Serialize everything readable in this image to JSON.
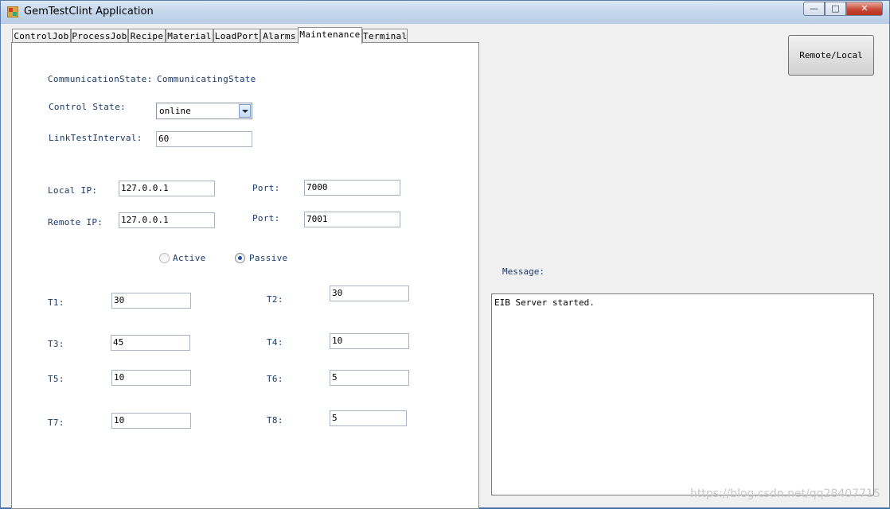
{
  "window": {
    "title": "GemTestClint Application",
    "controls": {
      "minimize": "—",
      "maximize": "□",
      "close": "✕"
    }
  },
  "tabs": [
    "ControlJob",
    "ProcessJob",
    "Recipe",
    "Material",
    "LoadPort",
    "Alarms",
    "Maintenance",
    "Terminal"
  ],
  "active_tab": "Maintenance",
  "maintenance": {
    "comm_state_label": "CommunicationState:",
    "comm_state_value": "CommunicatingState",
    "control_state_label": "Control State:",
    "control_state_value": "online",
    "link_test_label": "LinkTestInterval:",
    "link_test_value": "60",
    "local_ip_label": "Local IP:",
    "local_ip_value": "127.0.0.1",
    "local_port_label": "Port:",
    "local_port_value": "7000",
    "remote_ip_label": "Remote IP:",
    "remote_ip_value": "127.0.0.1",
    "remote_port_label": "Port:",
    "remote_port_value": "7001",
    "mode_active_label": "Active",
    "mode_passive_label": "Passive",
    "mode_selected": "Passive",
    "timers": {
      "t1_label": "T1:",
      "t1_value": "30",
      "t2_label": "T2:",
      "t2_value": "30",
      "t3_label": "T3:",
      "t3_value": "45",
      "t4_label": "T4:",
      "t4_value": "10",
      "t5_label": "T5:",
      "t5_value": "10",
      "t6_label": "T6:",
      "t6_value": "5",
      "t7_label": "T7:",
      "t7_value": "10",
      "t8_label": "T8:",
      "t8_value": "5"
    }
  },
  "remote_local_button": "Remote/Local",
  "message_label": "Message:",
  "message_text": "EIB Server started.",
  "watermark": "https://blog.csdn.net/qq28407715"
}
